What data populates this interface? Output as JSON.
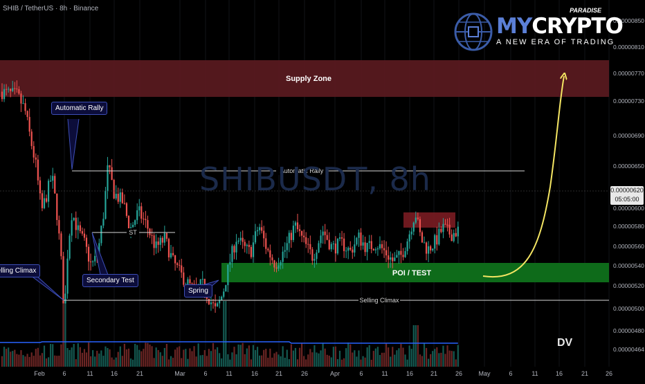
{
  "header": {
    "title": "SHIB / TetherUS · 8h · Binance",
    "watermark": "SHIBUSDT, 8h"
  },
  "logo": {
    "word_a": "MY",
    "word_b": "CRYPTO",
    "paradise": "PARADISE",
    "tagline": "A NEW ERA OF TRADING",
    "icon": "globe-circuit-icon"
  },
  "zones": {
    "supply": "Supply Zone",
    "poi": "POI / TEST"
  },
  "lines": {
    "automatic_rally": "Automatic Rally",
    "st": "ST",
    "selling_climax": "Selling Climax"
  },
  "callouts": {
    "automatic_rally": "Automatic Rally",
    "secondary_test": "Secondary Test",
    "spring": "Spring",
    "selling_climax": "Selling Climax"
  },
  "price_tag": {
    "price": "0.00000620",
    "countdown": "05:05:00"
  },
  "footer_mark": "DV",
  "colors": {
    "background": "#000000",
    "supply_zone": "#5a1a1f",
    "poi_zone": "#0e6b1a",
    "up_candle": "#26a69a",
    "down_candle": "#ef5350",
    "projection_arrow": "#f5e663",
    "volume_ma": "#2962ff"
  },
  "chart_data": {
    "type": "candlestick",
    "x_ticks": [
      "Feb",
      "6",
      "11",
      "16",
      "21",
      "Mar",
      "6",
      "11",
      "16",
      "21",
      "26",
      "Apr",
      "6",
      "11",
      "16",
      "21",
      "26",
      "May",
      "6",
      "11",
      "16",
      "21",
      "26"
    ],
    "y_ticks": [
      "0.00000850",
      "0.00000810",
      "0.00000770",
      "0.00000730",
      "0.00000690",
      "0.00000650",
      "0.00000600",
      "0.00000580",
      "0.00000560",
      "0.00000540",
      "0.00000520",
      "0.00000500",
      "0.00000480",
      "0.00000464"
    ],
    "levels": {
      "automatic_rally": 6.4e-06,
      "st": 5.75e-06,
      "selling_climax": 5.06e-06
    },
    "zones": {
      "supply": [
        7.3e-06,
        7.8e-06
      ],
      "poi_test": [
        5.27e-06,
        5.45e-06
      ],
      "minor_demand": [
        5.8e-06,
        6e-06
      ]
    },
    "last_price": 6.2e-06,
    "key_points": {
      "selling_climax_low": 5.06e-06,
      "automatic_rally_high": 7e-06,
      "secondary_test_low": 5.75e-06,
      "spring_low": 5.24e-06
    },
    "projection": {
      "from": 5.3e-06,
      "to": 7.75e-06
    }
  }
}
